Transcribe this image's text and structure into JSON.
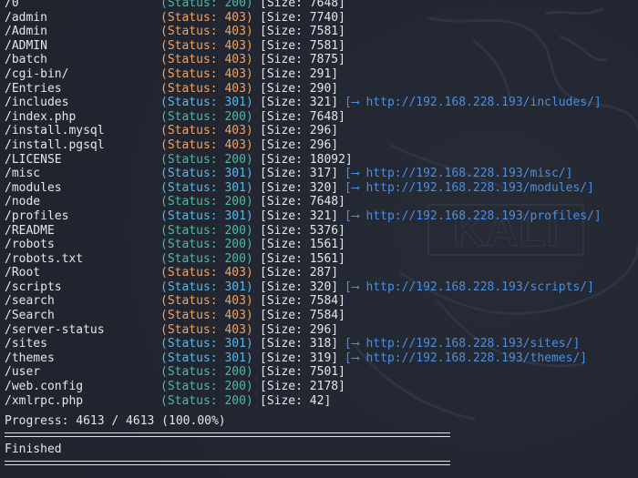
{
  "watermark": {
    "text": "KALI"
  },
  "results": [
    {
      "path": "/0",
      "status": "(Status: 200)",
      "code": 200,
      "size": "[Size: 7648]",
      "redirect": ""
    },
    {
      "path": "/admin",
      "status": "(Status: 403)",
      "code": 403,
      "size": "[Size: 7740]",
      "redirect": ""
    },
    {
      "path": "/Admin",
      "status": "(Status: 403)",
      "code": 403,
      "size": "[Size: 7581]",
      "redirect": ""
    },
    {
      "path": "/ADMIN",
      "status": "(Status: 403)",
      "code": 403,
      "size": "[Size: 7581]",
      "redirect": ""
    },
    {
      "path": "/batch",
      "status": "(Status: 403)",
      "code": 403,
      "size": "[Size: 7875]",
      "redirect": ""
    },
    {
      "path": "/cgi-bin/",
      "status": "(Status: 403)",
      "code": 403,
      "size": "[Size: 291]",
      "redirect": ""
    },
    {
      "path": "/Entries",
      "status": "(Status: 403)",
      "code": 403,
      "size": "[Size: 290]",
      "redirect": ""
    },
    {
      "path": "/includes",
      "status": "(Status: 301)",
      "code": 301,
      "size": "[Size: 321]",
      "redirect": "[⟶ http://192.168.228.193/includes/]"
    },
    {
      "path": "/index.php",
      "status": "(Status: 200)",
      "code": 200,
      "size": "[Size: 7648]",
      "redirect": ""
    },
    {
      "path": "/install.mysql",
      "status": "(Status: 403)",
      "code": 403,
      "size": "[Size: 296]",
      "redirect": ""
    },
    {
      "path": "/install.pgsql",
      "status": "(Status: 403)",
      "code": 403,
      "size": "[Size: 296]",
      "redirect": ""
    },
    {
      "path": "/LICENSE",
      "status": "(Status: 200)",
      "code": 200,
      "size": "[Size: 18092]",
      "redirect": ""
    },
    {
      "path": "/misc",
      "status": "(Status: 301)",
      "code": 301,
      "size": "[Size: 317]",
      "redirect": "[⟶ http://192.168.228.193/misc/]"
    },
    {
      "path": "/modules",
      "status": "(Status: 301)",
      "code": 301,
      "size": "[Size: 320]",
      "redirect": "[⟶ http://192.168.228.193/modules/]"
    },
    {
      "path": "/node",
      "status": "(Status: 200)",
      "code": 200,
      "size": "[Size: 7648]",
      "redirect": ""
    },
    {
      "path": "/profiles",
      "status": "(Status: 301)",
      "code": 301,
      "size": "[Size: 321]",
      "redirect": "[⟶ http://192.168.228.193/profiles/]"
    },
    {
      "path": "/README",
      "status": "(Status: 200)",
      "code": 200,
      "size": "[Size: 5376]",
      "redirect": ""
    },
    {
      "path": "/robots",
      "status": "(Status: 200)",
      "code": 200,
      "size": "[Size: 1561]",
      "redirect": ""
    },
    {
      "path": "/robots.txt",
      "status": "(Status: 200)",
      "code": 200,
      "size": "[Size: 1561]",
      "redirect": ""
    },
    {
      "path": "/Root",
      "status": "(Status: 403)",
      "code": 403,
      "size": "[Size: 287]",
      "redirect": ""
    },
    {
      "path": "/scripts",
      "status": "(Status: 301)",
      "code": 301,
      "size": "[Size: 320]",
      "redirect": "[⟶ http://192.168.228.193/scripts/]"
    },
    {
      "path": "/search",
      "status": "(Status: 403)",
      "code": 403,
      "size": "[Size: 7584]",
      "redirect": ""
    },
    {
      "path": "/Search",
      "status": "(Status: 403)",
      "code": 403,
      "size": "[Size: 7584]",
      "redirect": ""
    },
    {
      "path": "/server-status",
      "status": "(Status: 403)",
      "code": 403,
      "size": "[Size: 296]",
      "redirect": ""
    },
    {
      "path": "/sites",
      "status": "(Status: 301)",
      "code": 301,
      "size": "[Size: 318]",
      "redirect": "[⟶ http://192.168.228.193/sites/]"
    },
    {
      "path": "/themes",
      "status": "(Status: 301)",
      "code": 301,
      "size": "[Size: 319]",
      "redirect": "[⟶ http://192.168.228.193/themes/]"
    },
    {
      "path": "/user",
      "status": "(Status: 200)",
      "code": 200,
      "size": "[Size: 7501]",
      "redirect": ""
    },
    {
      "path": "/web.config",
      "status": "(Status: 200)",
      "code": 200,
      "size": "[Size: 2178]",
      "redirect": ""
    },
    {
      "path": "/xmlrpc.php",
      "status": "(Status: 200)",
      "code": 200,
      "size": "[Size: 42]",
      "redirect": ""
    }
  ],
  "progress": {
    "text": "Progress: 4613 / 4613 (100.00%)",
    "done": 4613,
    "total": 4613,
    "percent": 100.0
  },
  "finished_text": "Finished",
  "colors": {
    "background": "#222631",
    "text": "#e3e6ea",
    "status_200": "#4fb8a6",
    "status_301": "#5bb6e8",
    "status_403": "#f5a25d",
    "redirect_link": "#4a8fe0"
  }
}
